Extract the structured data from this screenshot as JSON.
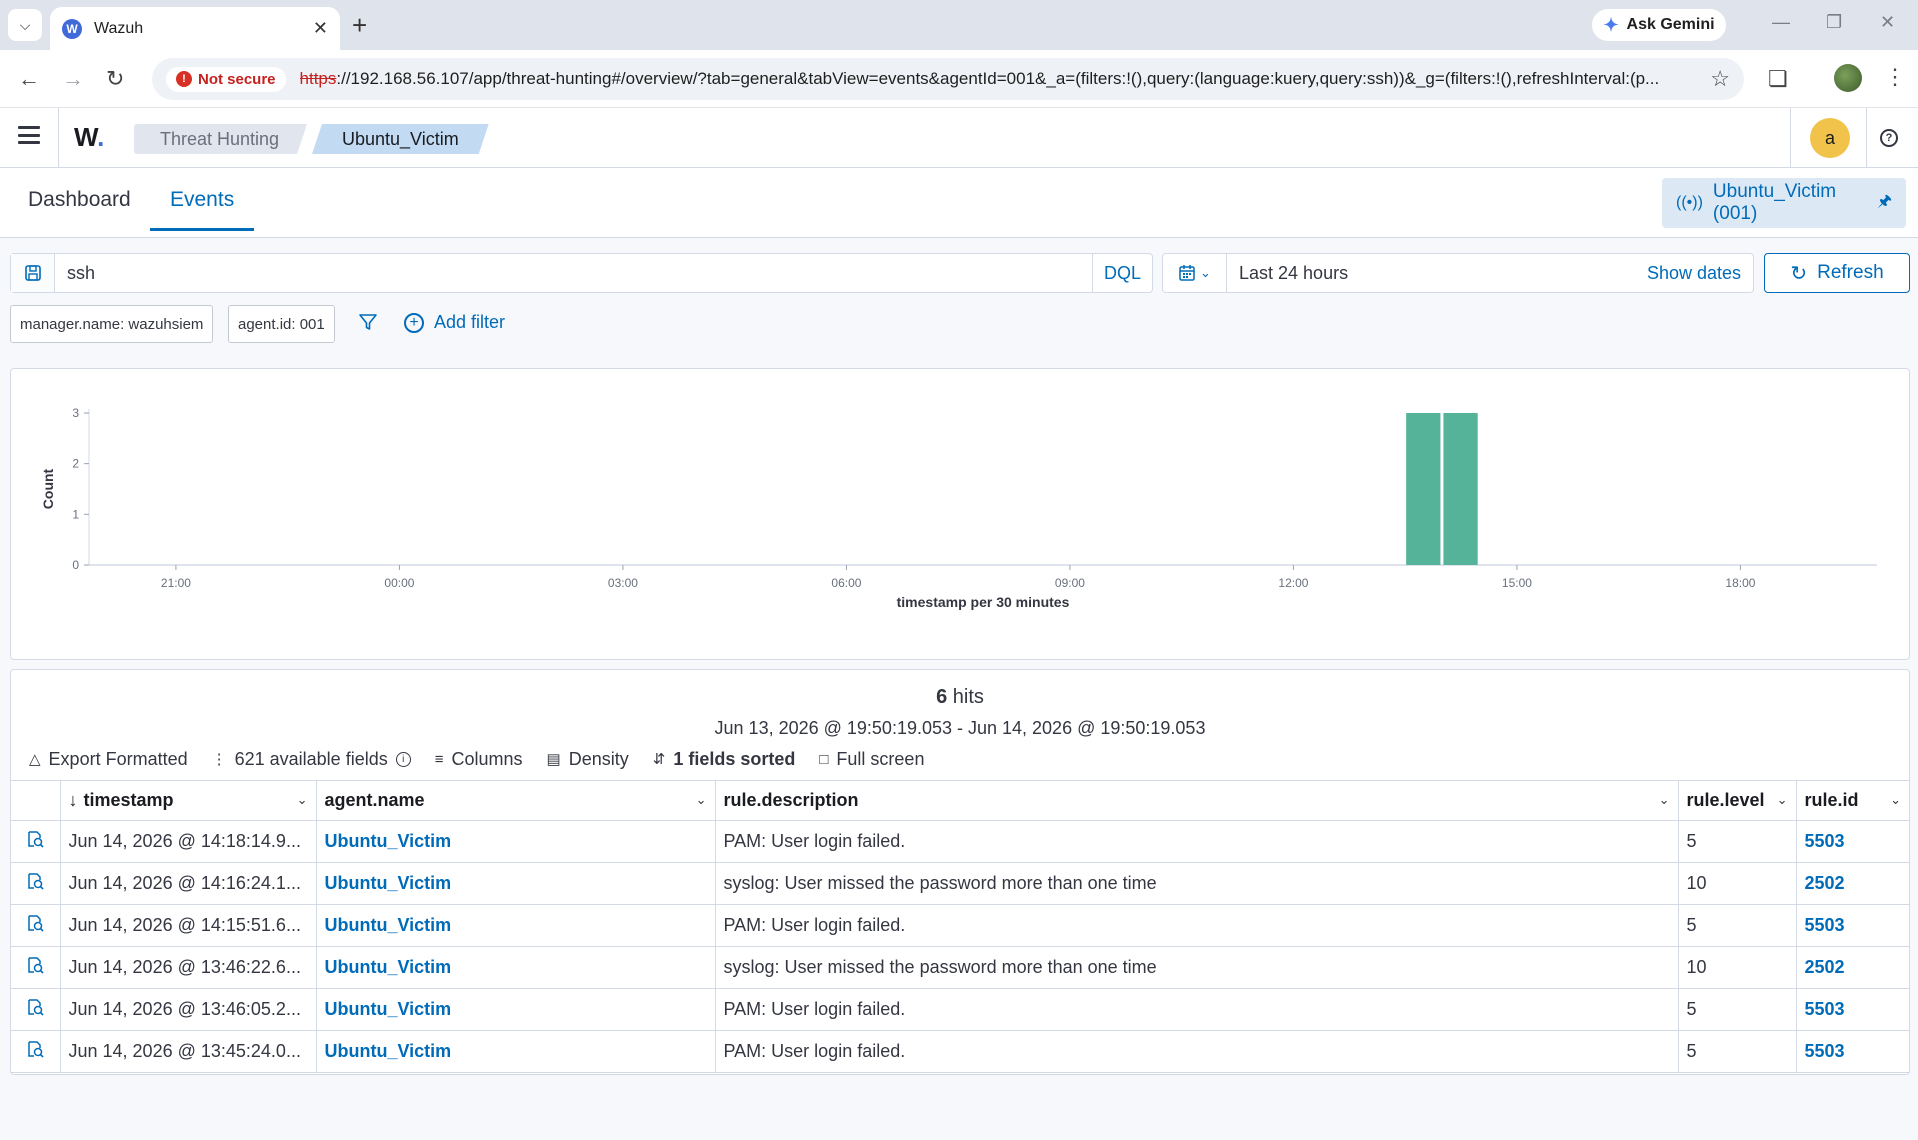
{
  "browser": {
    "tab_title": "Wazuh",
    "tab_favicon": "W",
    "ask_gemini": "Ask Gemini",
    "not_secure": "Not secure",
    "url_scheme": "https",
    "url_rest": "://192.168.56.107/app/threat-hunting#/overview/?tab=general&tabView=events&agentId=001&_a=(filters:!(),query:(language:kuery,query:ssh))&_g=(filters:!(),refreshInterval:(p..."
  },
  "header": {
    "logo": "W",
    "breadcrumbs": [
      "Threat Hunting",
      "Ubuntu_Victim"
    ],
    "avatar_letter": "a"
  },
  "tabs": [
    {
      "label": "Dashboard",
      "active": false
    },
    {
      "label": "Events",
      "active": true
    }
  ],
  "agent_pill": "Ubuntu_Victim (001)",
  "query": {
    "text": "ssh",
    "language": "DQL"
  },
  "time": {
    "range": "Last 24 hours",
    "show_dates": "Show dates",
    "refresh": "Refresh"
  },
  "filters": {
    "pills": [
      "manager.name: wazuhsiem",
      "agent.id: 001"
    ],
    "add_filter": "Add filter"
  },
  "chart_data": {
    "type": "bar",
    "ylabel": "Count",
    "xlabel": "timestamp per 30 minutes",
    "ylim": [
      0,
      3
    ],
    "yticks": [
      0,
      1,
      2,
      3
    ],
    "x_ticks": [
      "21:00",
      "00:00",
      "03:00",
      "06:00",
      "09:00",
      "12:00",
      "15:00",
      "18:00"
    ],
    "x_range_hours": [
      19.8333,
      43.8333
    ],
    "x_tick_hours": [
      21,
      24,
      27,
      30,
      33,
      36,
      39,
      42
    ],
    "bars": [
      {
        "start_hour": 37.5,
        "end_hour": 38.0,
        "value": 3
      },
      {
        "start_hour": 38.0,
        "end_hour": 38.5,
        "value": 3
      }
    ],
    "bar_color": "#54b399"
  },
  "results": {
    "hits_count": "6",
    "hits_label": "hits",
    "range": "Jun 13, 2026 @ 19:50:19.053 - Jun 14, 2026 @ 19:50:19.053",
    "toolbar": {
      "export": "Export Formatted",
      "fields": "621 available fields",
      "columns": "Columns",
      "density": "Density",
      "sorted": "1 fields sorted",
      "fullscreen": "Full screen"
    },
    "columns": [
      "timestamp",
      "agent.name",
      "rule.description",
      "rule.level",
      "rule.id"
    ],
    "rows": [
      {
        "timestamp": "Jun 14, 2026 @ 14:18:14.9...",
        "agent": "Ubuntu_Victim",
        "description": "PAM: User login failed.",
        "level": "5",
        "rule_id": "5503"
      },
      {
        "timestamp": "Jun 14, 2026 @ 14:16:24.1...",
        "agent": "Ubuntu_Victim",
        "description": "syslog: User missed the password more than one time",
        "level": "10",
        "rule_id": "2502"
      },
      {
        "timestamp": "Jun 14, 2026 @ 14:15:51.6...",
        "agent": "Ubuntu_Victim",
        "description": "PAM: User login failed.",
        "level": "5",
        "rule_id": "5503"
      },
      {
        "timestamp": "Jun 14, 2026 @ 13:46:22.6...",
        "agent": "Ubuntu_Victim",
        "description": "syslog: User missed the password more than one time",
        "level": "10",
        "rule_id": "2502"
      },
      {
        "timestamp": "Jun 14, 2026 @ 13:46:05.2...",
        "agent": "Ubuntu_Victim",
        "description": "PAM: User login failed.",
        "level": "5",
        "rule_id": "5503"
      },
      {
        "timestamp": "Jun 14, 2026 @ 13:45:24.0...",
        "agent": "Ubuntu_Victim",
        "description": "PAM: User login failed.",
        "level": "5",
        "rule_id": "5503"
      }
    ]
  },
  "colors": {
    "accent": "#006bb8",
    "bar": "#54b399",
    "error": "#d93025"
  }
}
